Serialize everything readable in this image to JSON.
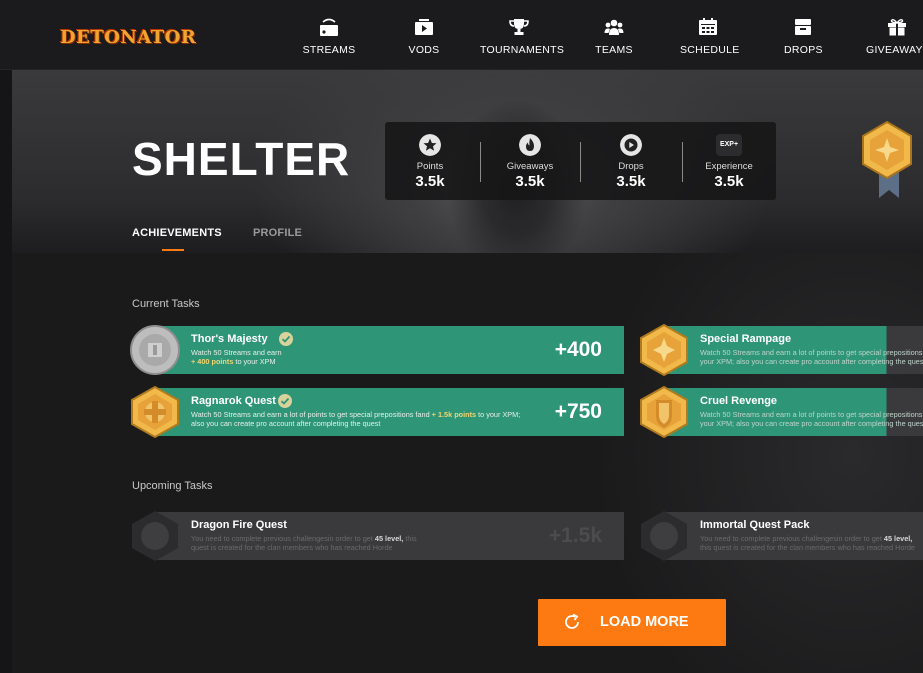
{
  "brand": {
    "logo_text": "DETONATOR",
    "accent": "#fd7a12",
    "task_green": "#2f9577",
    "gold": "#e9b343"
  },
  "nav": [
    {
      "label": "STREAMS",
      "icon": "streams-icon"
    },
    {
      "label": "VODS",
      "icon": "vods-icon"
    },
    {
      "label": "TOURNAMENTS",
      "icon": "trophy-icon"
    },
    {
      "label": "TEAMS",
      "icon": "teams-icon"
    },
    {
      "label": "SCHEDULE",
      "icon": "calendar-icon"
    },
    {
      "label": "DROPS",
      "icon": "drops-icon"
    },
    {
      "label": "GIVEAWAYS",
      "icon": "gift-icon"
    }
  ],
  "hero": {
    "title": "SHELTER",
    "stats": [
      {
        "label": "Points",
        "value": "3.5k",
        "icon": "star-icon"
      },
      {
        "label": "Giveaways",
        "value": "3.5k",
        "icon": "flame-icon"
      },
      {
        "label": "Drops",
        "value": "3.5k",
        "icon": "play-icon"
      },
      {
        "label": "Experience",
        "value": "3.5k",
        "icon": "exp-icon",
        "icon_text": "EXP+"
      }
    ]
  },
  "tabs": [
    {
      "label": "ACHIEVEMENTS",
      "active": true
    },
    {
      "label": "PROFILE",
      "active": false
    }
  ],
  "current": {
    "title": "Current Tasks",
    "tasks": [
      {
        "name": "Thor's Majesty",
        "desc_pre": "Watch 50 Streams and earn",
        "desc_bold": "+ 400 points",
        "desc_post": "to your XPM",
        "points": "+400",
        "medal": "silver"
      },
      {
        "name": "Special Rampage",
        "desc_pre": "Watch 50 Streams and earn a lot of points to get special prepositions fand",
        "desc_bold": "",
        "desc_post": "your XPM; also you can create pro account after completing the quest",
        "points": "",
        "medal": "gold-hex"
      },
      {
        "name": "Ragnarok Quest",
        "desc_pre": "Watch 50 Streams and earn a lot of points to get special prepositions fand",
        "desc_bold": "+ 1.5k points",
        "desc_post": "to your XPM; also you can create pro account after completing the quest",
        "points": "+750",
        "medal": "gold-hex-cross"
      },
      {
        "name": "Cruel Revenge",
        "desc_pre": "Watch 50 Streams and earn a lot of points to get special prepositions fand",
        "desc_bold": "",
        "desc_post": "your XPM; also you can create pro account after completing the quest",
        "points": "",
        "medal": "gold-shield"
      }
    ]
  },
  "upcoming": {
    "title": "Upcoming Tasks",
    "tasks": [
      {
        "name": "Dragon Fire Quest",
        "desc_pre": "You need to complete previous challengesin order to get",
        "desc_bold": "45 level,",
        "desc_post": "this quest is created for the clan members who has reached Horde",
        "points": "+1.5k"
      },
      {
        "name": "Immortal Quest Pack",
        "desc_pre": "You need to complete previous challengesin order to get",
        "desc_bold": "45 level,",
        "desc_post": "this quest is created for the clan members who has reached Horde",
        "points": ""
      }
    ]
  },
  "load_more": {
    "label": "LOAD MORE",
    "icon": "refresh-icon"
  }
}
